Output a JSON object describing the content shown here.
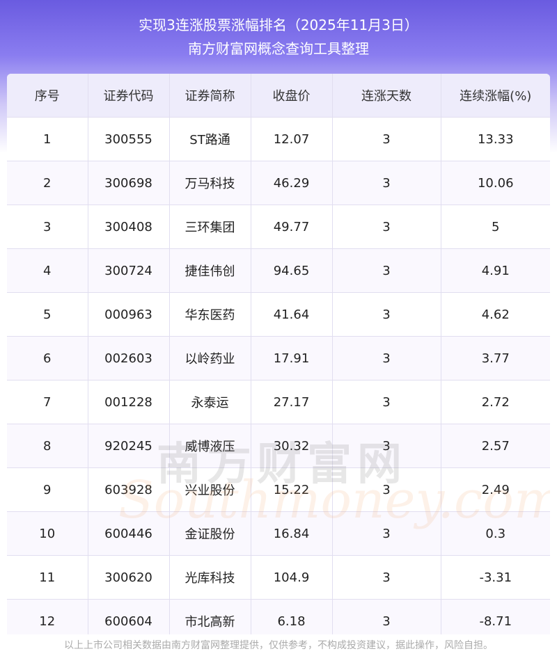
{
  "header": {
    "title": "实现3连涨股票涨幅排名（2025年11月3日）",
    "subtitle": "南方财富网概念查询工具整理"
  },
  "table": {
    "columns": [
      "序号",
      "证券代码",
      "证券简称",
      "收盘价",
      "连涨天数",
      "连续涨幅(%)"
    ],
    "rows": [
      [
        "1",
        "300555",
        "ST路通",
        "12.07",
        "3",
        "13.33"
      ],
      [
        "2",
        "300698",
        "万马科技",
        "46.29",
        "3",
        "10.06"
      ],
      [
        "3",
        "300408",
        "三环集团",
        "49.77",
        "3",
        "5"
      ],
      [
        "4",
        "300724",
        "捷佳伟创",
        "94.65",
        "3",
        "4.91"
      ],
      [
        "5",
        "000963",
        "华东医药",
        "41.64",
        "3",
        "4.62"
      ],
      [
        "6",
        "002603",
        "以岭药业",
        "17.91",
        "3",
        "3.77"
      ],
      [
        "7",
        "001228",
        "永泰运",
        "27.17",
        "3",
        "2.72"
      ],
      [
        "8",
        "920245",
        "威博液压",
        "30.32",
        "3",
        "2.57"
      ],
      [
        "9",
        "603928",
        "兴业股份",
        "15.22",
        "3",
        "2.49"
      ],
      [
        "10",
        "600446",
        "金证股份",
        "16.84",
        "3",
        "0.3"
      ],
      [
        "11",
        "300620",
        "光库科技",
        "104.9",
        "3",
        "-3.31"
      ],
      [
        "12",
        "600604",
        "市北高新",
        "6.18",
        "3",
        "-8.71"
      ]
    ]
  },
  "watermark": {
    "cn": "南方财富网",
    "en": "Southmoney.com"
  },
  "footer": {
    "disclaimer": "以上上市公司相关数据由南方财富网整理提供，仅供参考，不构成投资建议，据此操作，风险自担。"
  }
}
